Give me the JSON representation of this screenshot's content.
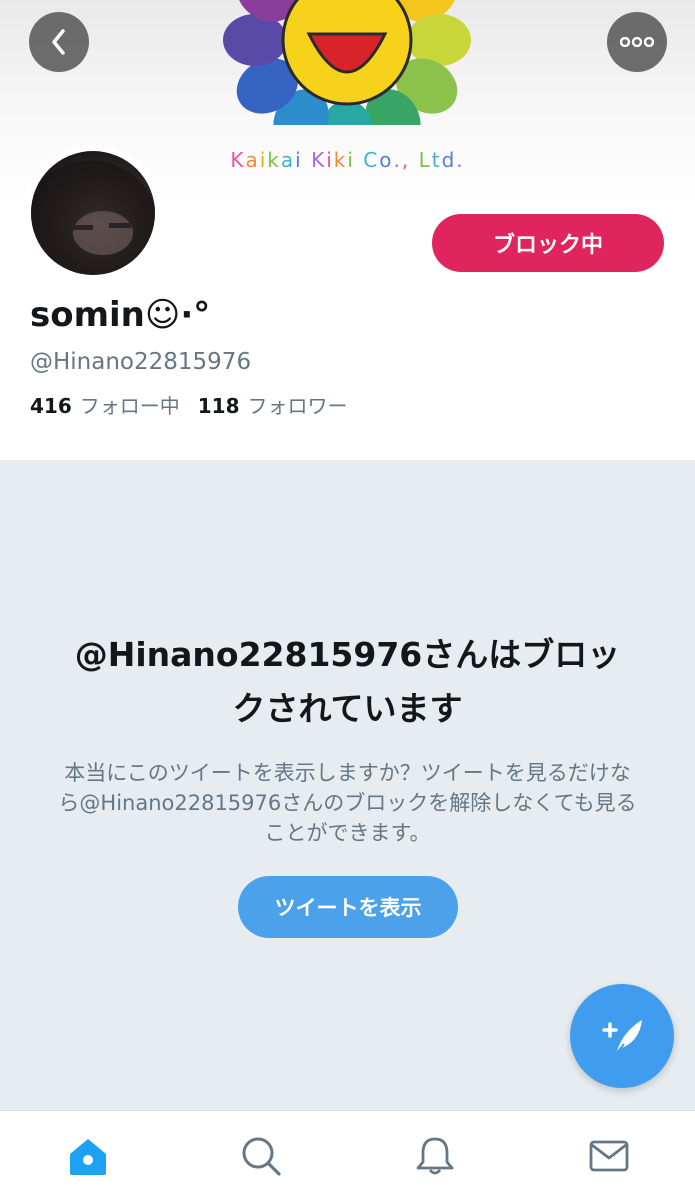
{
  "header": {
    "brand_letters": [
      {
        "ch": "K",
        "color": "#e8569a"
      },
      {
        "ch": "a",
        "color": "#f08a3a"
      },
      {
        "ch": "i",
        "color": "#d6b21f"
      },
      {
        "ch": "k",
        "color": "#7cc14a"
      },
      {
        "ch": "a",
        "color": "#3fb4c8"
      },
      {
        "ch": "i",
        "color": "#5b7be0"
      },
      {
        "ch": " ",
        "color": "#000000"
      },
      {
        "ch": "K",
        "color": "#b264d6"
      },
      {
        "ch": "i",
        "color": "#e8569a"
      },
      {
        "ch": "k",
        "color": "#f08a3a"
      },
      {
        "ch": "i",
        "color": "#7cc14a"
      },
      {
        "ch": " ",
        "color": "#000000"
      },
      {
        "ch": "C",
        "color": "#3fb4c8"
      },
      {
        "ch": "o",
        "color": "#5b7be0"
      },
      {
        "ch": ".",
        "color": "#b264d6"
      },
      {
        "ch": ",",
        "color": "#e8569a"
      },
      {
        "ch": " ",
        "color": "#000000"
      },
      {
        "ch": "L",
        "color": "#7cc14a"
      },
      {
        "ch": "t",
        "color": "#3fb4c8"
      },
      {
        "ch": "d",
        "color": "#5b7be0"
      },
      {
        "ch": ".",
        "color": "#b264d6"
      }
    ],
    "back_icon": "chevron-left-icon",
    "more_icon": "more-horizontal-icon"
  },
  "profile": {
    "block_button_label": "ブロック中",
    "display_name": "somin☺︎·°",
    "handle": "@Hinano22815976",
    "following_count": "416",
    "following_label": "フォロー中",
    "followers_count": "118",
    "followers_label": "フォロワー"
  },
  "blocked": {
    "title": "@Hinano22815976さんはブロックされています",
    "description": "本当にこのツイートを表示しますか？ツイートを見るだけなら@Hinano22815976さんのブロックを解除しなくても見ることができます。",
    "show_button_label": "ツイートを表示"
  },
  "tabbar": {
    "items": [
      {
        "icon": "home-icon",
        "active": true
      },
      {
        "icon": "search-icon",
        "active": false
      },
      {
        "icon": "bell-icon",
        "active": false
      },
      {
        "icon": "mail-icon",
        "active": false
      }
    ]
  },
  "colors": {
    "block_button": "#e0245e",
    "accent_blue": "#4ba1ea",
    "gray_background": "#e6ecf0",
    "secondary_text": "#657786"
  }
}
